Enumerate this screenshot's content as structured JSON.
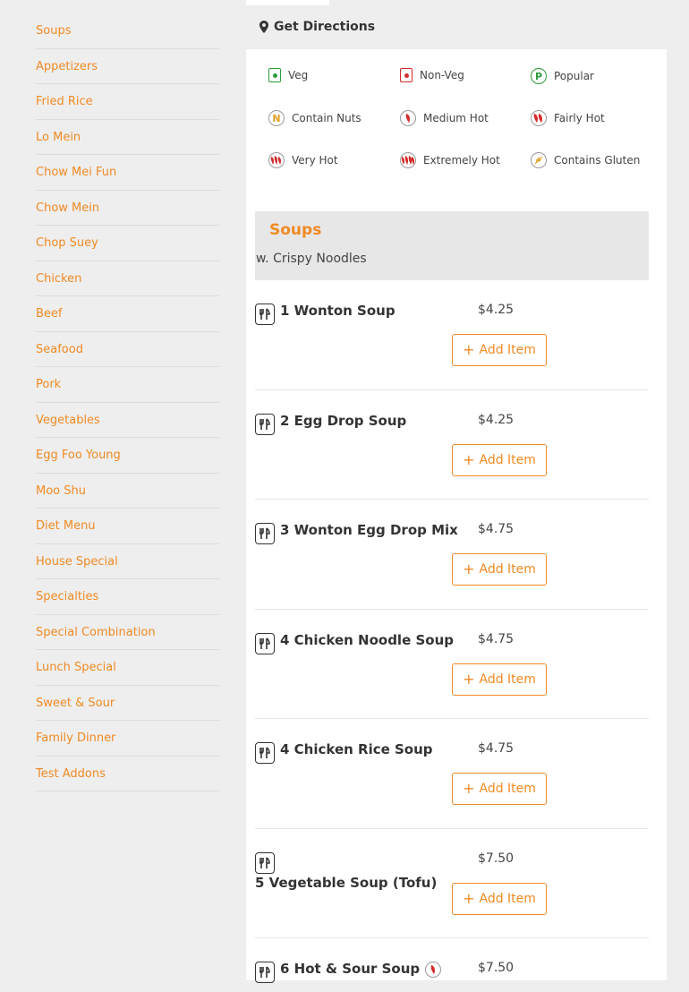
{
  "sidebar": {
    "categories": [
      "Soups",
      "Appetizers",
      "Fried Rice",
      "Lo Mein",
      "Chow Mei Fun",
      "Chow Mein",
      "Chop Suey",
      "Chicken",
      "Beef",
      "Seafood",
      "Pork",
      "Vegetables",
      "Egg Foo Young",
      "Moo Shu",
      "Diet Menu",
      "House Special",
      "Specialties",
      "Special Combination",
      "Lunch Special",
      "Sweet & Sour",
      "Family Dinner",
      "Test Addons"
    ]
  },
  "header": {
    "directions_label": "Get Directions"
  },
  "legend": {
    "veg": "Veg",
    "non_veg": "Non-Veg",
    "popular": "Popular",
    "nuts": "Contain Nuts",
    "medium_hot": "Medium Hot",
    "fairly_hot": "Fairly Hot",
    "very_hot": "Very Hot",
    "extremely_hot": "Extremely Hot",
    "gluten": "Contains Gluten"
  },
  "section": {
    "title": "Soups",
    "description": "w. Crispy Noodles"
  },
  "add_label": "Add Item",
  "items": [
    {
      "name": "1 Wonton Soup",
      "price": "$4.25"
    },
    {
      "name": "2 Egg Drop Soup",
      "price": "$4.25"
    },
    {
      "name": "3 Wonton Egg Drop Mix",
      "price": "$4.75"
    },
    {
      "name": "4 Chicken Noodle Soup",
      "price": "$4.75"
    },
    {
      "name": "4 Chicken Rice Soup",
      "price": "$4.75"
    },
    {
      "name": "5 Vegetable Soup (Tofu)",
      "price": "$7.50"
    },
    {
      "name": "6 Hot & Sour Soup",
      "price": "$7.50"
    }
  ],
  "colors": {
    "accent": "#f08a24",
    "veg": "#2a9d3a",
    "non_veg": "#d62b2b",
    "chili": "#d62b2b"
  }
}
